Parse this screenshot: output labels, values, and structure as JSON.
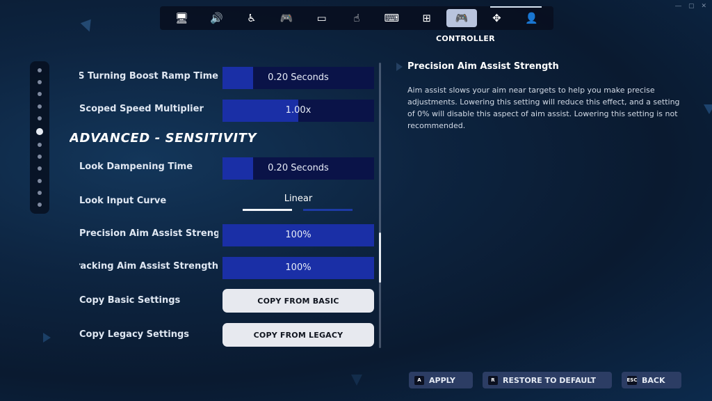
{
  "nav": {
    "items": [
      {
        "icon": "monitor-icon",
        "glyph": "🖥"
      },
      {
        "icon": "speaker-icon",
        "glyph": "🔊"
      },
      {
        "icon": "accessibility-icon",
        "glyph": "♿"
      },
      {
        "icon": "gamepad-touch-icon",
        "glyph": "🎮"
      },
      {
        "icon": "window-icon",
        "glyph": "▭"
      },
      {
        "icon": "touch-icon",
        "glyph": "☝"
      },
      {
        "icon": "keyboard-mouse-icon",
        "glyph": "⌨"
      },
      {
        "icon": "network-icon",
        "glyph": "⊞"
      },
      {
        "icon": "controller-icon",
        "glyph": "🎮",
        "active": true
      },
      {
        "icon": "dpad-icon",
        "glyph": "✥"
      },
      {
        "icon": "account-icon",
        "glyph": "👤"
      }
    ],
    "active_label": "CONTROLLER"
  },
  "pager": {
    "count": 12,
    "active_index": 5
  },
  "settings": {
    "turning_boost_ramp": {
      "label": "ADS Turning Boost Ramp Time",
      "value": "0.20 Seconds",
      "level": 0.2
    },
    "scoped_speed": {
      "label": "Scoped Speed Multiplier",
      "value": "1.00x",
      "level": 0.5
    },
    "section_title": "ADVANCED - SENSITIVITY",
    "look_dampening": {
      "label": "Look Dampening Time",
      "value": "0.20 Seconds",
      "level": 0.2
    },
    "look_input_curve": {
      "label": "Look Input Curve",
      "value": "Linear"
    },
    "precision_aim": {
      "label": "Precision Aim Assist Strength",
      "value": "100%",
      "level": 1.0
    },
    "tracking_aim": {
      "label": "Tracking Aim Assist Strength",
      "value": "100%",
      "level": 1.0
    },
    "copy_basic": {
      "label": "Copy Basic Settings",
      "button": "COPY FROM BASIC"
    },
    "copy_legacy": {
      "label": "Copy Legacy Settings",
      "button": "COPY FROM LEGACY"
    }
  },
  "description": {
    "title": "Precision Aim Assist Strength",
    "text": "Aim assist slows your aim near targets to help you make precise adjustments.  Lowering this setting will reduce this effect, and a setting of 0% will disable this aspect of aim assist. Lowering this setting is not recommended."
  },
  "actions": {
    "apply": {
      "key": "A",
      "label": "APPLY"
    },
    "restore": {
      "key": "R",
      "label": "RESTORE TO DEFAULT"
    },
    "back": {
      "key": "ESC",
      "label": "BACK"
    }
  },
  "colors": {
    "accent_fill": "#1a2fa6",
    "slider_bg": "#0a1348",
    "active_tab": "#b9c4dd"
  }
}
